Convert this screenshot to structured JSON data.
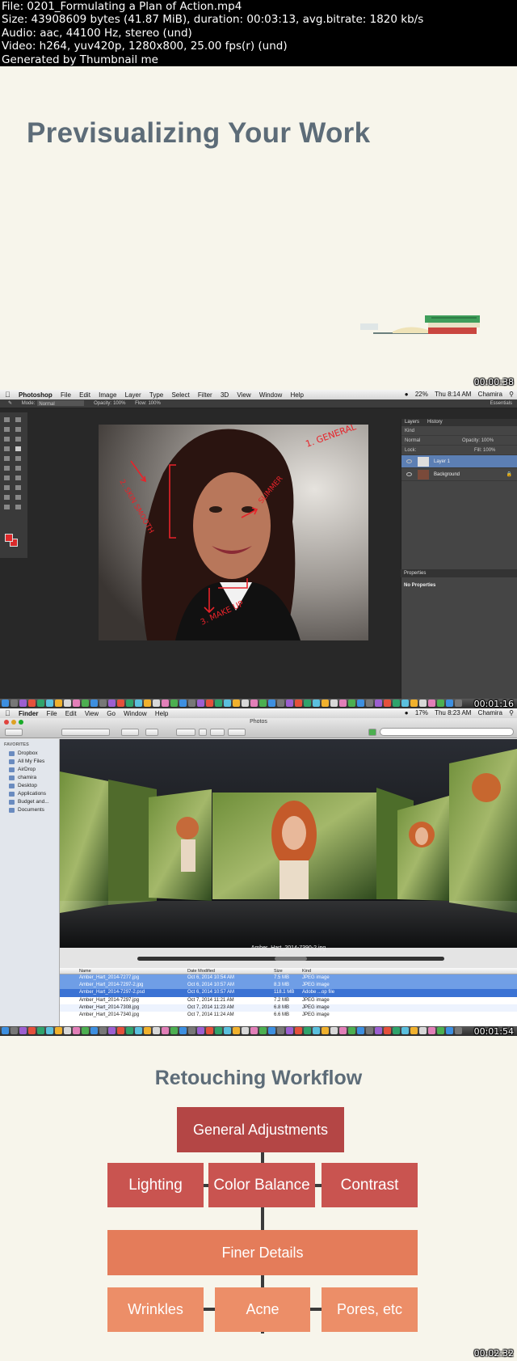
{
  "meta": {
    "line1": "File: 0201_Formulating a Plan of Action.mp4",
    "line2": "Size: 43908609 bytes (41.87 MiB), duration: 00:03:13, avg.bitrate: 1820 kb/s",
    "line3": "Audio: aac, 44100 Hz, stereo (und)",
    "line4": "Video: h264, yuv420p, 1280x800, 25.00 fps(r) (und)",
    "line5": "Generated by Thumbnail me"
  },
  "frame1": {
    "title": "Previsualizing Your Work",
    "timestamp": "00:00:38"
  },
  "frame2": {
    "menubar": {
      "app": "Photoshop",
      "items": [
        "File",
        "Edit",
        "Image",
        "Layer",
        "Type",
        "Select",
        "Filter",
        "3D",
        "View",
        "Window",
        "Help"
      ],
      "battery": "22%",
      "clock": "Thu 8:14 AM",
      "user": "Chamira"
    },
    "options": {
      "mode_label": "Mode:",
      "mode_value": "Normal",
      "opacity_label": "Opacity:",
      "opacity_value": "100%",
      "flow_label": "Flow:",
      "flow_value": "100%",
      "workspace": "Essentials"
    },
    "annotations": {
      "a1": "1. GENERAL",
      "a2": "2. SKIN SMOOTH",
      "a3": "3. MAKE UP",
      "a4": "SLIMMER"
    },
    "layers_panel": {
      "tabs": [
        "Layers",
        "History"
      ],
      "kind": "Kind",
      "blend": "Normal",
      "opacity_label": "Opacity:",
      "opacity_value": "100%",
      "lock_label": "Lock:",
      "fill_label": "Fill:",
      "fill_value": "100%",
      "layers": [
        "Layer 1",
        "Background"
      ]
    },
    "properties": {
      "tab": "Properties",
      "body": "No Properties"
    },
    "colors": {
      "foreground": "#e0282a",
      "background": "#d92a2a"
    },
    "timestamp": "00:01:16"
  },
  "frame3": {
    "menubar": {
      "app": "Finder",
      "items": [
        "File",
        "Edit",
        "View",
        "Go",
        "Window",
        "Help"
      ],
      "battery": "17%",
      "clock": "Thu 8:23 AM",
      "user": "Chamira"
    },
    "window_title": "Photos",
    "sidebar": {
      "heading": "FAVORITES",
      "items": [
        "Dropbox",
        "All My Files",
        "AirDrop",
        "chamira",
        "Desktop",
        "Applications",
        "Budget and...",
        "Documents"
      ]
    },
    "coverflow_caption": "Amber_Hart_2014-7390-2.jpg",
    "table": {
      "headers": [
        "Name",
        "Date Modified",
        "Size",
        "Kind"
      ],
      "rows": [
        [
          "Amber_Hart_2014-7277.jpg",
          "Oct 6, 2014 10:54 AM",
          "7.5 MB",
          "JPEG image"
        ],
        [
          "Amber_Hart_2014-7297-2.jpg",
          "Oct 6, 2014 10:57 AM",
          "8.3 MB",
          "JPEG image"
        ],
        [
          "Amber_Hart_2014-7297-2.psd",
          "Oct 6, 2014 10:57 AM",
          "118.1 MB",
          "Adobe ...op file"
        ],
        [
          "Amber_Hart_2014-7297.jpg",
          "Oct 7, 2014 11:21 AM",
          "7.2 MB",
          "JPEG image"
        ],
        [
          "Amber_Hart_2014-7308.jpg",
          "Oct 7, 2014 11:23 AM",
          "6.8 MB",
          "JPEG image"
        ],
        [
          "Amber_Hart_2014-7340.jpg",
          "Oct 7, 2014 11:24 AM",
          "6.6 MB",
          "JPEG image"
        ]
      ]
    },
    "timestamp": "00:01:54"
  },
  "frame4": {
    "title": "Retouching Workflow",
    "general": "General Adjustments",
    "level2": [
      "Lighting",
      "Color Balance",
      "Contrast"
    ],
    "finer": "Finer Details",
    "level4": [
      "Wrinkles",
      "Acne",
      "Pores, etc"
    ],
    "colors": {
      "level1": "#b44645",
      "level2": "#c95450",
      "level3": "#e47c5a",
      "level4": "#ec8e68"
    },
    "timestamp": "00:02:32"
  }
}
